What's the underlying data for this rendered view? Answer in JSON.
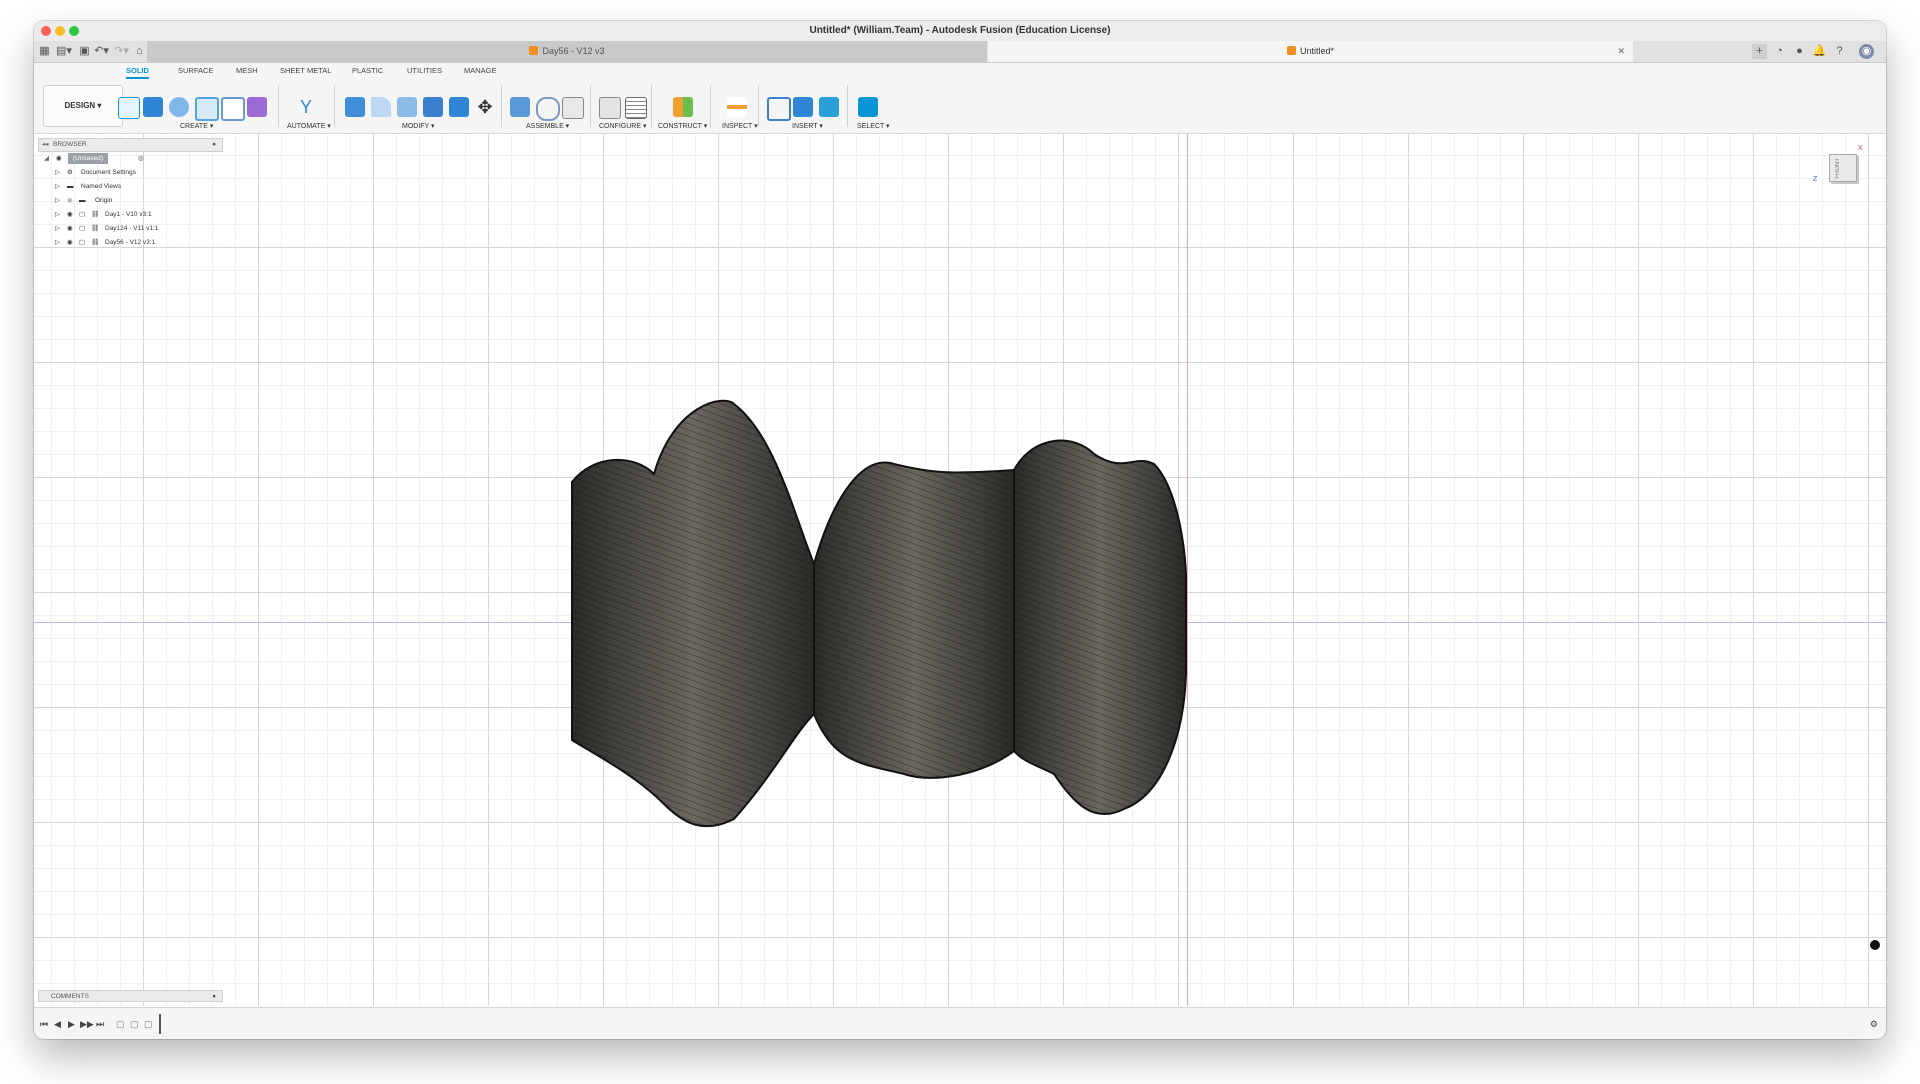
{
  "window": {
    "title": "Untitled* (William.Team) - Autodesk Fusion (Education License)"
  },
  "tabs": [
    {
      "label": "Day56 - V12 v3",
      "active": false
    },
    {
      "label": "Untitled*",
      "active": true
    }
  ],
  "workspace": {
    "label": "DESIGN ▾"
  },
  "ribbon_tabs": [
    "SOLID",
    "SURFACE",
    "MESH",
    "SHEET METAL",
    "PLASTIC",
    "UTILITIES",
    "MANAGE"
  ],
  "tool_groups": {
    "create": "CREATE ▾",
    "automate": "AUTOMATE ▾",
    "modify": "MODIFY ▾",
    "assemble": "ASSEMBLE ▾",
    "configure": "CONFIGURE ▾",
    "construct": "CONSTRUCT ▾",
    "inspect": "INSPECT ▾",
    "insert": "INSERT ▾",
    "select": "SELECT ▾"
  },
  "browser": {
    "title": "BROWSER",
    "root": "(Unsaved)",
    "items": [
      "Document Settings",
      "Named Views",
      "Origin",
      "Day1 - V10 v3:1",
      "Day124 - V11 v1:1",
      "Day56 - V12 v3:1"
    ]
  },
  "comments": {
    "title": "COMMENTS"
  },
  "viewcube": {
    "face": "FRONT",
    "axis_x": "X",
    "axis_z": "Z"
  },
  "colors": {
    "accent": "#0696d7",
    "body": "#5d5a52",
    "xaxis": "#f1a4a4",
    "zaxis": "#b7b6ea"
  }
}
